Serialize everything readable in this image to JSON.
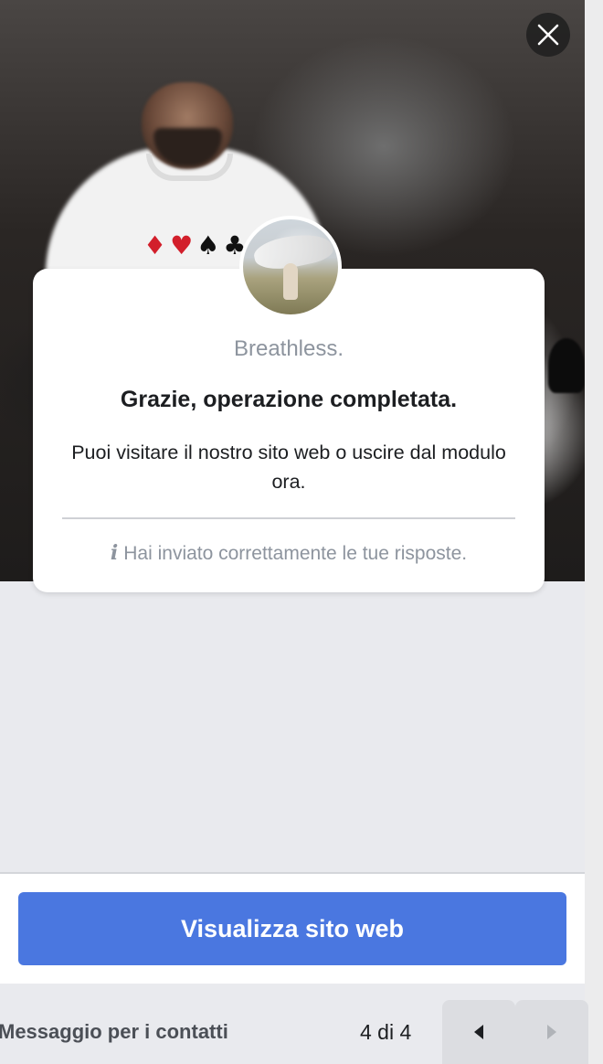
{
  "card": {
    "brand": "Breathless.",
    "title": "Grazie, operazione completata.",
    "message": "Puoi visitare il nostro sito web o uscire dal modulo ora.",
    "info_icon": "i",
    "info_text": "Hai inviato correttamente le tue risposte."
  },
  "cta": {
    "label": "Visualizza sito web",
    "color": "#4a77e0"
  },
  "footer": {
    "label": "Messaggio per i contatti",
    "page_count": "4 di 4"
  },
  "icons": {
    "close": "close-icon",
    "prev": "triangle-left-icon",
    "next": "triangle-right-icon",
    "info": "info-icon"
  }
}
